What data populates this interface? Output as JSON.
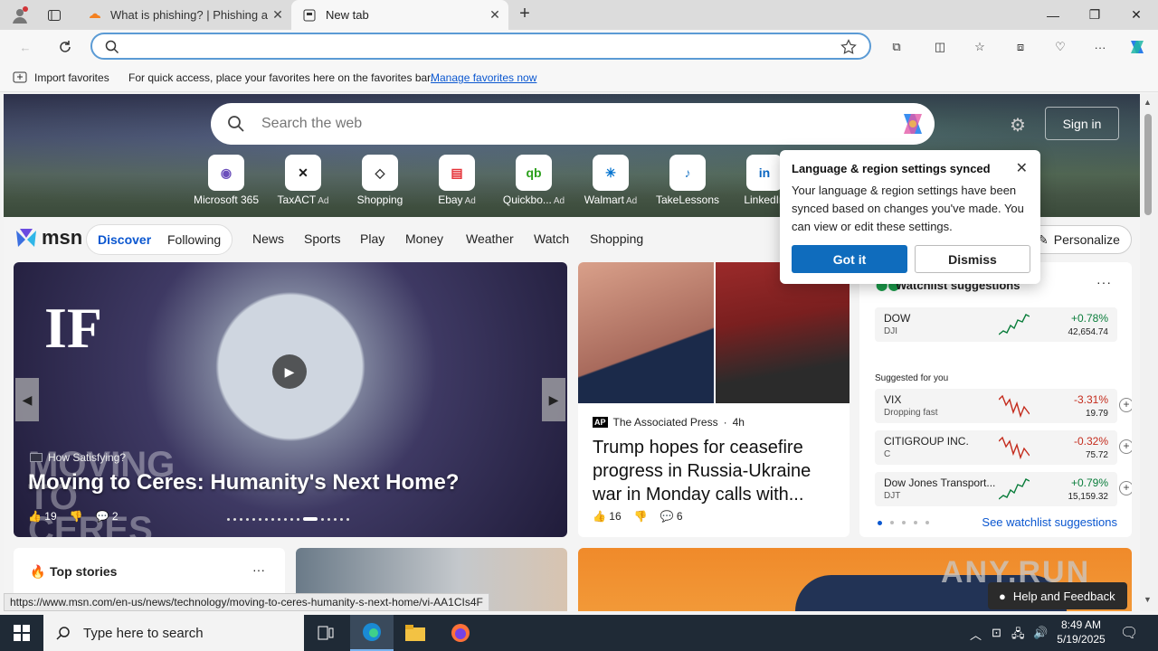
{
  "browser": {
    "tabs": [
      {
        "title": "What is phishing? | Phishing atta",
        "active": false
      },
      {
        "title": "New tab",
        "active": true
      }
    ],
    "address_value": "",
    "favbar": {
      "import_label": "Import favorites",
      "message": "For quick access, place your favorites here on the favorites bar.",
      "link": "Manage favorites now"
    }
  },
  "newtab": {
    "search_placeholder": "Search the web",
    "signin_label": "Sign in",
    "quick_links": [
      {
        "label": "Microsoft 365",
        "ad": "",
        "glyph": "◉",
        "color": "#6b4fbb"
      },
      {
        "label": "TaxACT",
        "ad": "Ad",
        "glyph": "✕",
        "color": "#1a1a1a"
      },
      {
        "label": "Shopping",
        "ad": "",
        "glyph": "◇",
        "color": "#333333"
      },
      {
        "label": "Ebay",
        "ad": "Ad",
        "glyph": "▤",
        "color": "#e53238"
      },
      {
        "label": "Quickbo...",
        "ad": "Ad",
        "glyph": "qb",
        "color": "#2ca01c"
      },
      {
        "label": "Walmart",
        "ad": "Ad",
        "glyph": "✳",
        "color": "#0071ce"
      },
      {
        "label": "TakeLessons",
        "ad": "",
        "glyph": "♪",
        "color": "#2a7fc9"
      },
      {
        "label": "LinkedIn",
        "ad": "",
        "glyph": "in",
        "color": "#0a66c2"
      }
    ]
  },
  "msn": {
    "logo_text": "msn",
    "tabs": {
      "discover": "Discover",
      "following": "Following"
    },
    "nav": [
      "News",
      "Sports",
      "Play",
      "Money",
      "Weather",
      "Watch",
      "Shopping"
    ],
    "personalize": "Personalize"
  },
  "feature": {
    "source": "How Satisfying?",
    "headline": "Moving to Ceres: Humanity's Next Home?",
    "likes": "19",
    "comments": "2",
    "overlay_text": "MOVING TO CERES"
  },
  "news": {
    "source": "The Associated Press",
    "age": "4h",
    "headline": "Trump hopes for ceasefire progress in Russia-Ukraine war in Monday calls with...",
    "likes": "16",
    "comments": "6"
  },
  "watchlist": {
    "title": "Watchlist suggestions",
    "suggested_label": "Suggested for you",
    "see_link": "See watchlist suggestions",
    "items": [
      {
        "name": "DOW",
        "ticker": "DJI",
        "change": "+0.78%",
        "price": "42,654.74",
        "dir": "up",
        "note": ""
      },
      {
        "name": "VIX",
        "ticker": "Dropping fast",
        "change": "-3.31%",
        "price": "19.79",
        "dir": "down",
        "note": "fast"
      },
      {
        "name": "CITIGROUP INC.",
        "ticker": "C",
        "change": "-0.32%",
        "price": "75.72",
        "dir": "down",
        "note": ""
      },
      {
        "name": "Dow Jones Transport...",
        "ticker": "DJT",
        "change": "+0.79%",
        "price": "15,159.32",
        "dir": "up",
        "note": ""
      }
    ]
  },
  "topstories": {
    "title": "Top stories"
  },
  "popup": {
    "title": "Language & region settings synced",
    "body": "Your language & region settings have been synced based on changes you've made. You can view or edit these settings.",
    "primary": "Got it",
    "secondary": "Dismiss"
  },
  "help_feedback": "Help and Feedback",
  "watermark": "ANY.RUN",
  "status_url": "https://www.msn.com/en-us/news/technology/moving-to-ceres-humanity-s-next-home/vi-AA1CIs4F",
  "taskbar": {
    "search_placeholder": "Type here to search",
    "time": "8:49 AM",
    "date": "5/19/2025"
  }
}
